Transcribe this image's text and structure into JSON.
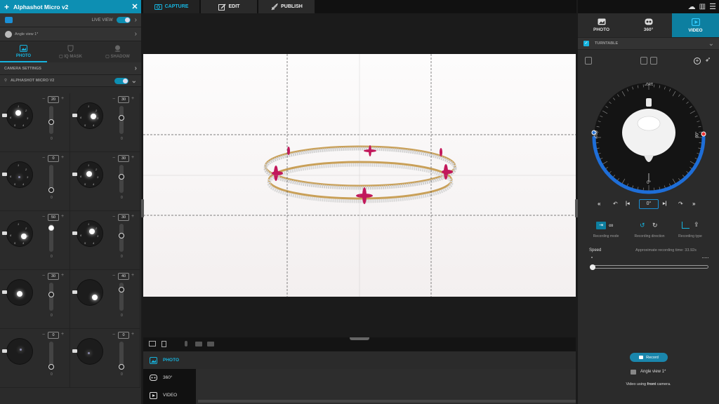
{
  "app": {
    "title": "Alphashot Micro v2"
  },
  "left": {
    "live_view": "LIVE VIEW",
    "on": "ON",
    "angle": "Angle view 1*",
    "tabs": [
      {
        "label": "PHOTO"
      },
      {
        "label": "IQ MASK"
      },
      {
        "label": "SHADOW"
      }
    ],
    "camera_settings": "CAMERA SETTINGS",
    "device": "ALPHASHOT MICRO V2",
    "lights": [
      {
        "value": "20",
        "level": 0.4,
        "min": "0"
      },
      {
        "value": "30",
        "level": 0.6,
        "min": "0"
      },
      {
        "value": "0",
        "level": 0.0,
        "min": "0"
      },
      {
        "value": "30",
        "level": 0.6,
        "min": "0"
      },
      {
        "value": "50",
        "level": 0.95,
        "min": "0"
      },
      {
        "value": "30",
        "level": 0.6,
        "min": "0"
      },
      {
        "value": "30",
        "level": 0.6,
        "min": "0"
      },
      {
        "value": "40",
        "level": 0.8,
        "min": "0"
      },
      {
        "value": "0",
        "level": 0.0,
        "min": "0"
      },
      {
        "value": "0",
        "level": 0.0,
        "min": "0"
      }
    ]
  },
  "topnav": [
    {
      "label": "CAPTURE"
    },
    {
      "label": "EDIT"
    },
    {
      "label": "PUBLISH"
    }
  ],
  "bottom": {
    "items": [
      {
        "label": "PHOTO"
      },
      {
        "label": "360°"
      },
      {
        "label": "VIDEO"
      }
    ]
  },
  "right": {
    "tabs": [
      {
        "label": "PHOTO"
      },
      {
        "label": "360°"
      },
      {
        "label": "VIDEO"
      }
    ],
    "turntable": "TURNTABLE",
    "dial": {
      "top": "180°",
      "left": "270°",
      "right": "90°",
      "bottom": "0°"
    },
    "angle_value": "0°",
    "recording": [
      {
        "label": "Recording mode"
      },
      {
        "label": "Recording direction"
      },
      {
        "label": "Recording type"
      }
    ],
    "speed_label": "Speed",
    "approx": "Approximate recording time: 33.92s",
    "speed_level": 0,
    "record_btn": "Record",
    "angle_view": "Angle view 1*",
    "video_note_pre": "Video using ",
    "video_note_bold": "front",
    "video_note_post": " camera."
  },
  "colors": {
    "accent": "#16b4df",
    "ring": "#1e6ed8"
  }
}
